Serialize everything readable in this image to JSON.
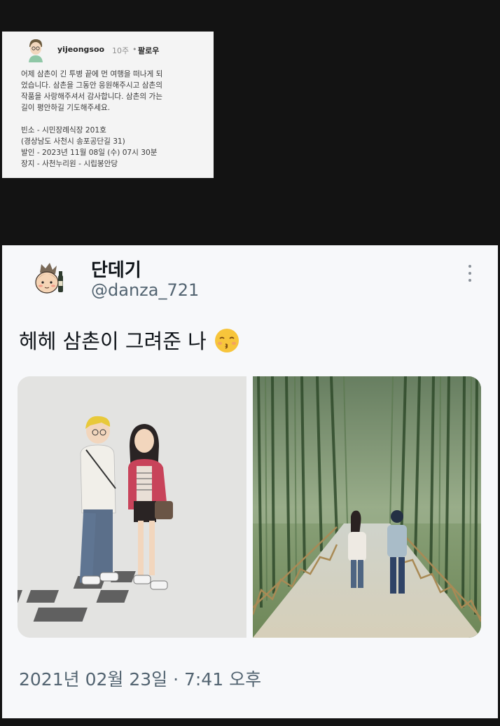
{
  "comment": {
    "username": "yijeongsoo",
    "time": "10주",
    "separator": "•",
    "follow_label": "팔로우",
    "body_lines": [
      "어제 삼촌이 긴 투병 끝에 먼 여행을 떠나게 되",
      "었습니다. 삼촌을 그동안 응원해주시고 삼촌의",
      "작품을 사랑해주셔서 감사합니다. 삼촌의 가는",
      "길이 평안하길 기도해주세요."
    ],
    "info_lines": [
      "빈소 - 시민장례식장 201호",
      "(경상남도 사천시 송포공단길 31)",
      "발인 - 2023년 11월 08일 (수) 07시 30분",
      "장지 - 사천누리원 - 시립봉안당"
    ]
  },
  "tweet": {
    "display_name": "단데기",
    "handle": "@danza_721",
    "text": "헤헤 삼촌이 그려준 나",
    "emoji_icon": "kissing-face-closed-eyes-icon",
    "images": [
      {
        "description_icon": "illustration-couple-standing"
      },
      {
        "description_icon": "illustration-bamboo-forest-path"
      }
    ],
    "date": "2021년 02월 23일 · 7:41 오후"
  },
  "colors": {
    "page_background": "#131313",
    "card_background": "#f7f8fa",
    "handle_gray": "#536471"
  }
}
